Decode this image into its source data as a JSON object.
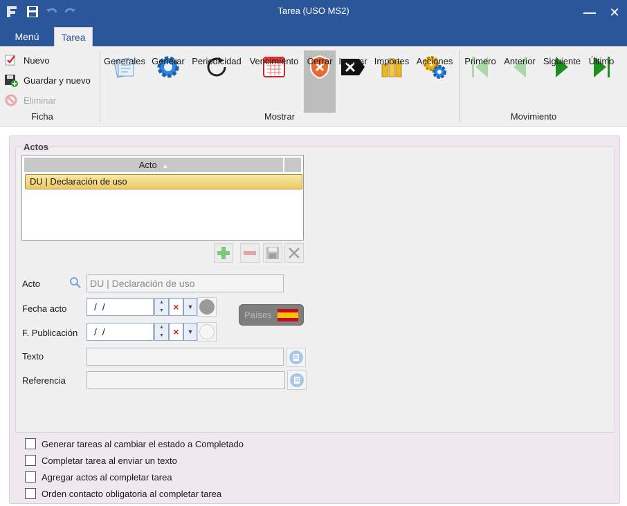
{
  "window": {
    "title": "Tarea (USO MS2)",
    "minimize": "—",
    "close": "✕"
  },
  "tabs": {
    "menu": "Menú",
    "active": "Tarea"
  },
  "ribbon": {
    "ficha": {
      "label": "Ficha",
      "nuevo": "Nuevo",
      "guardar_nuevo": "Guardar y nuevo",
      "eliminar": "Eliminar"
    },
    "mostrar": {
      "label": "Mostrar",
      "generales": "Generales",
      "generar": "Generar",
      "periodicidad": "Periodicidad",
      "vencimiento": "Vencimiento",
      "cerrar": "Cerrar",
      "ignorar": "Ignorar",
      "importes": "Importes",
      "acciones": "Acciones"
    },
    "movimiento": {
      "label": "Movimiento",
      "primero": "Primero",
      "anterior": "Anterior",
      "siguiente": "Siguiente",
      "ultimo": "Último"
    }
  },
  "actos": {
    "legend": "Actos",
    "column_header": "Acto",
    "sort_indicator": "▲",
    "rows": [
      {
        "text": "DU | Declaración de uso"
      }
    ]
  },
  "form": {
    "acto_label": "Acto",
    "acto_value": "DU | Declaración de uso",
    "fecha_acto_label": "Fecha acto",
    "fecha_acto_value": "/  /",
    "fpub_label": "F. Publicación",
    "fpub_value": "/  /",
    "texto_label": "Texto",
    "texto_value": "",
    "referencia_label": "Referencia",
    "referencia_value": "",
    "paises_label": "Países"
  },
  "options": [
    {
      "label": "Generar tareas al cambiar el estado a Completado",
      "checked": false
    },
    {
      "label": "Completar tarea al enviar un texto",
      "checked": false
    },
    {
      "label": "Agregar actos al completar tarea",
      "checked": false
    },
    {
      "label": "Orden contacto obligatoria al completar tarea",
      "checked": false
    }
  ],
  "colors": {
    "titlebar": "#2b579a",
    "accent_green": "#1e8e1e",
    "selection": "#f3d97a"
  }
}
